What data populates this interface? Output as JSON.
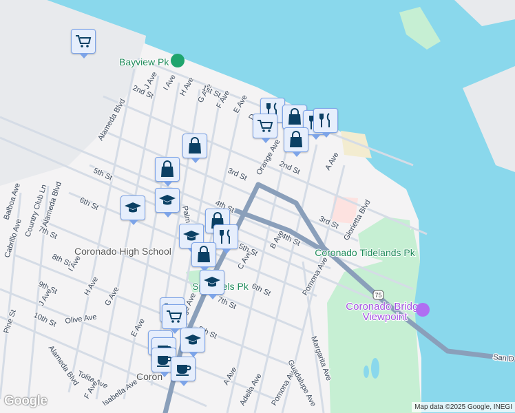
{
  "map": {
    "parks": [
      "Bayview Pk",
      "Coronado Tidelands Pk",
      "Spreckels Pk"
    ],
    "poi": {
      "line1": "Coronado Bridge",
      "line2": "Viewpoint"
    },
    "school": "Coronado High School",
    "city": "Coron",
    "highway_shield": "75",
    "streets": [
      "J Ave",
      "I Ave",
      "H Ave",
      "G Ave",
      "F Ave",
      "E Ave",
      "D",
      "1st St",
      "2nd St",
      "Alameda Blvd",
      "3rd St",
      "5th St",
      "6th St",
      "4th St",
      "Palm Ave",
      "Orange Ave",
      "2nd St",
      "A Ave",
      "3rd St",
      "Glorietta Blvd",
      "4th St",
      "B Ave",
      "C Ave",
      "5th St",
      "6th St",
      "Pomona Ave",
      "7th St",
      "8th St",
      "Alameda Blvd",
      "Country Club Ln",
      "Cabrillo Ave",
      "Balboa Ave",
      "I Ave",
      "H Ave",
      "G Ave",
      "9th St",
      "J Ave",
      "10th St",
      "Olive Ave",
      "Pine St",
      "Alameda Blvd",
      "Tolita Ave",
      "F Ave",
      "Isabella Ave",
      "E Ave",
      "8th St",
      "A Ave",
      "Adella Ave",
      "Pomona Ave",
      "Margarita Ave",
      "Guadalupe Ave",
      "San D",
      "Orange Ave",
      "7th St"
    ]
  },
  "markers": [
    "shopping-cart",
    "shopping-bag",
    "shopping-bag",
    "graduation-cap",
    "graduation-cap",
    "shopping-bag",
    "restaurant",
    "graduation-cap",
    "shopping-bag",
    "graduation-cap",
    "shopping-cart",
    "shopping-cart",
    "coffee",
    "coffee",
    "graduation-cap",
    "coffee",
    "coffee",
    "restaurant",
    "shopping-cart",
    "shopping-bag",
    "restaurant",
    "shopping-bag",
    "restaurant"
  ],
  "branding": {
    "logo": "Google",
    "attribution": "Map data ©2025 Google, INEGI"
  }
}
